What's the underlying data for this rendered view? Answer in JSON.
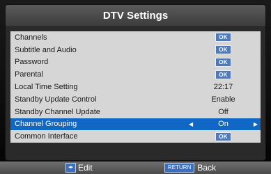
{
  "title": "DTV Settings",
  "menu": {
    "items": [
      {
        "label": "Channels",
        "value": "OK"
      },
      {
        "label": "Subtitle and Audio",
        "value": "OK"
      },
      {
        "label": "Password",
        "value": "OK"
      },
      {
        "label": "Parental",
        "value": "OK"
      },
      {
        "label": "Local Time Setting",
        "value": "22:17"
      },
      {
        "label": "Standby Update Control",
        "value": "Enable"
      },
      {
        "label": "Standby Channel Update",
        "value": "Off"
      },
      {
        "label": "Channel Grouping",
        "value": "On"
      },
      {
        "label": "Common Interface",
        "value": "OK"
      }
    ],
    "selected_index": 7
  },
  "footer": {
    "edit_label": "Edit",
    "nav_key_icon": "left-right-arrows-icon",
    "return_key": "RETURN",
    "back_label": "Back"
  },
  "colors": {
    "selection": "#1266c4",
    "ok_badge": "#4f79b8"
  }
}
